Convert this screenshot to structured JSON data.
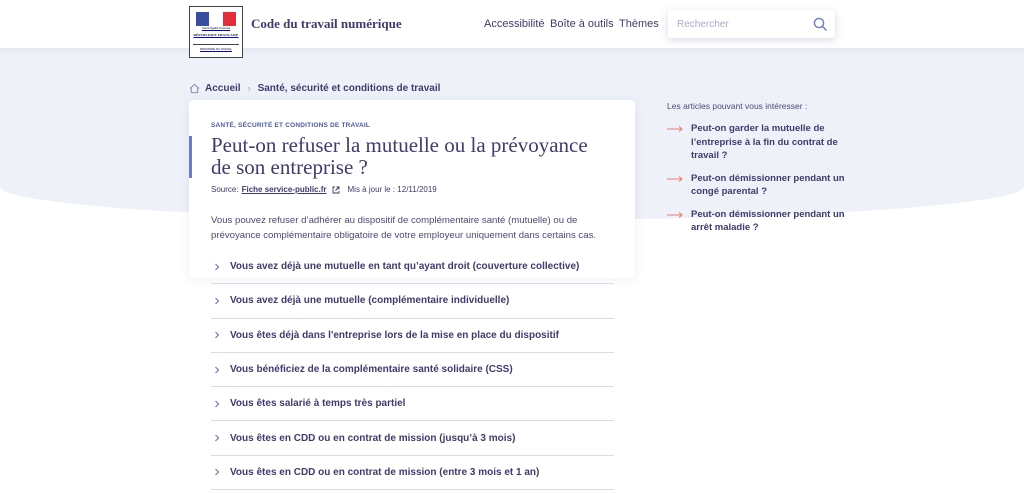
{
  "header": {
    "logo_text": "RÉPUBLIQUE FRANÇAISE",
    "logo_motto": "Liberté Égalité Fraternité",
    "logo_ministry": "MINISTÈRE DU TRAVAIL",
    "site_title": "Code du travail numérique",
    "nav": [
      {
        "label": "Accessibilité"
      },
      {
        "label": "Boîte à outils"
      },
      {
        "label": "Thèmes"
      }
    ],
    "search_placeholder": "Rechercher"
  },
  "breadcrumb": {
    "home": "Accueil",
    "current": "Santé, sécurité et conditions de travail"
  },
  "article": {
    "category": "SANTÉ, SÉCURITÉ ET CONDITIONS DE TRAVAIL",
    "title": "Peut-on refuser la mutuelle ou la prévoyance de son entreprise ?",
    "source_label": "Source:",
    "source_link": "Fiche service-public.fr",
    "updated": "Mis à jour le : 12/11/2019",
    "intro": "Vous pouvez refuser d’adhérer au dispositif de complémentaire santé (mutuelle) ou de prévoyance complémentaire obligatoire de votre employeur uniquement dans certains cas.",
    "sections": [
      {
        "label": "Vous avez déjà une mutuelle en tant qu’ayant droit (couverture collective)"
      },
      {
        "label": "Vous avez déjà une mutuelle (complémentaire individuelle)"
      },
      {
        "label": "Vous êtes déjà dans l'entreprise lors de la mise en place du dispositif"
      },
      {
        "label": "Vous bénéficiez de la complémentaire santé solidaire (CSS)"
      },
      {
        "label": "Vous êtes salarié à temps très partiel"
      },
      {
        "label": "Vous êtes en CDD ou en contrat de mission (jusqu’à 3 mois)"
      },
      {
        "label": "Vous êtes en CDD ou en contrat de mission (entre 3 mois et 1 an)"
      }
    ]
  },
  "related": {
    "title": "Les articles pouvant vous intéresser :",
    "items": [
      {
        "label": "Peut-on garder la mutuelle de l’entreprise à la fin du contrat de travail ?"
      },
      {
        "label": "Peut-on démissionner pendant un congé parental ?"
      },
      {
        "label": "Peut-on démissionner pendant un arrêt maladie ?"
      }
    ]
  },
  "colors": {
    "primary_text": "#3e3b6e",
    "accent_blue": "#4b5aa3",
    "accent_red": "#e87a6f",
    "background_band": "#eef1f8"
  }
}
